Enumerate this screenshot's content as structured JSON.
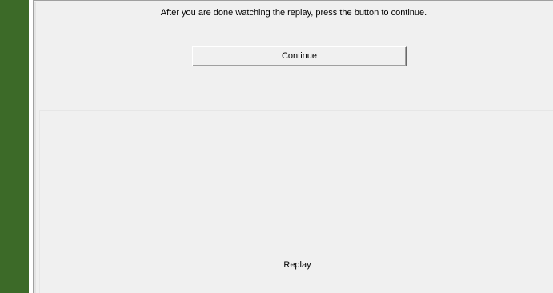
{
  "colors": {
    "sidebar": "#3c6a28",
    "panel_background": "#f0f0f0"
  },
  "header": {
    "instruction_text": "After you are done watching the replay, press the button to continue."
  },
  "actions": {
    "continue_label": "Continue"
  },
  "replay": {
    "label": "Replay"
  }
}
